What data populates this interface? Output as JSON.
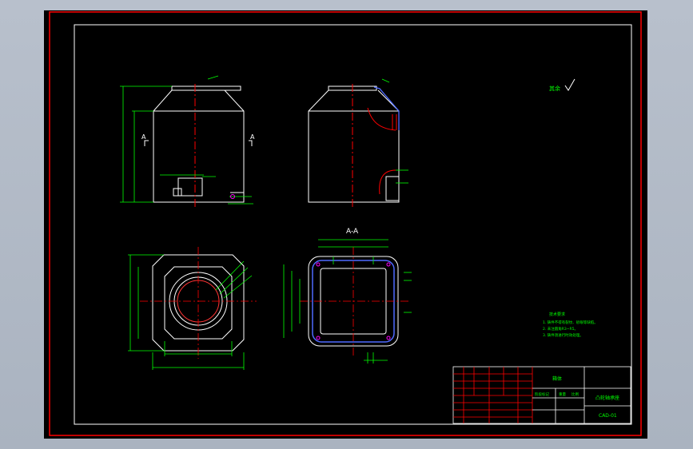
{
  "section_label": "A-A",
  "view_labels": {
    "left_cut": "A",
    "right_cut": "A"
  },
  "roughness_note": "其余",
  "tech_notes": {
    "title": "技术要求",
    "lines": [
      "1. 铸件不得有裂纹、砂眼等缺陷。",
      "2. 未注圆角R3~R5。",
      "3. 铸件须进行时效处理。"
    ]
  },
  "title_block": {
    "part_name": "箱体",
    "drawing_name": "凸轮轴承座",
    "drawing_number": "CAD-01",
    "stage_label": "阶段标记",
    "scale_label": "比例",
    "weight_label": "重量"
  },
  "colors": {
    "sheet_bg": "#000000",
    "outer_frame": "#ff0000",
    "inner_frame": "#ffffff",
    "outline": "#ffffff",
    "dimension": "#00ff00",
    "center_line": "#ff0000",
    "hidden_line": "#0000ff",
    "accent_magenta": "#ff00ff",
    "title_block_grid": "#ff0000"
  }
}
